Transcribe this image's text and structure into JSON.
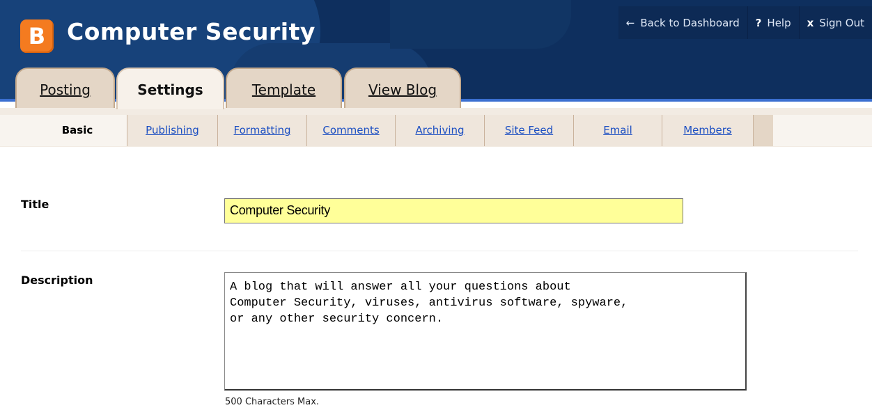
{
  "header": {
    "logo_letter": "B",
    "blog_title": "Computer Security",
    "links": [
      {
        "glyph": "←",
        "label": "Back to Dashboard"
      },
      {
        "glyph": "?",
        "label": "Help"
      },
      {
        "glyph": "x",
        "label": "Sign Out"
      }
    ]
  },
  "main_tabs": [
    {
      "label": "Posting",
      "active": false
    },
    {
      "label": "Settings",
      "active": true
    },
    {
      "label": "Template",
      "active": false
    },
    {
      "label": "View Blog",
      "active": false
    }
  ],
  "sub_tabs": [
    {
      "label": "Basic",
      "active": true
    },
    {
      "label": "Publishing",
      "active": false
    },
    {
      "label": "Formatting",
      "active": false
    },
    {
      "label": "Comments",
      "active": false
    },
    {
      "label": "Archiving",
      "active": false
    },
    {
      "label": "Site Feed",
      "active": false
    },
    {
      "label": "Email",
      "active": false
    },
    {
      "label": "Members",
      "active": false
    }
  ],
  "form": {
    "title_label": "Title",
    "title_value": "Computer Security",
    "description_label": "Description",
    "description_value": "A blog that will answer all your questions about\nComputer Security, viruses, antivirus software, spyware,\nor any other security concern.",
    "description_hint": "500 Characters Max."
  },
  "colors": {
    "header_bg": "#0e2f5e",
    "logo_orange": "#f47b20",
    "title_input_bg": "#ffff99",
    "link_blue": "#1c4fc2"
  }
}
